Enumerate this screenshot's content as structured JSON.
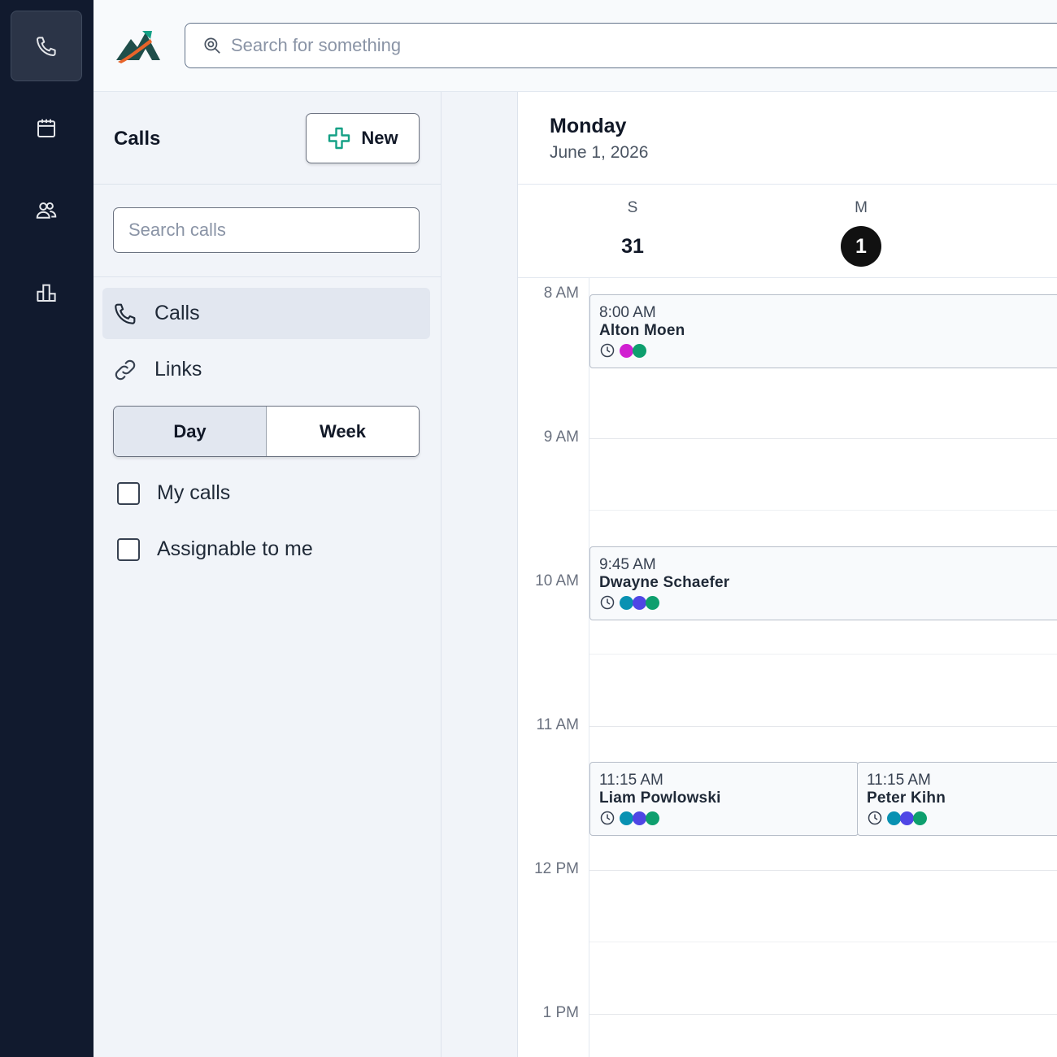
{
  "rail": {
    "items": [
      {
        "icon": "phone-icon",
        "active": true
      },
      {
        "icon": "calendar-icon",
        "active": false
      },
      {
        "icon": "users-icon",
        "active": false
      },
      {
        "icon": "reports-icon",
        "active": false
      }
    ]
  },
  "topbar": {
    "search_placeholder": "Search for something"
  },
  "panel": {
    "title": "Calls",
    "new_label": "New",
    "search_placeholder": "Search calls",
    "nav": [
      {
        "label": "Calls",
        "icon": "phone-icon",
        "active": true
      },
      {
        "label": "Links",
        "icon": "link-icon",
        "active": false
      }
    ],
    "view_toggle": {
      "day": "Day",
      "week": "Week",
      "selected": "Day"
    },
    "filters": [
      {
        "label": "My calls",
        "checked": false
      },
      {
        "label": "Assignable to me",
        "checked": false
      }
    ]
  },
  "calendar": {
    "day_name": "Monday",
    "date": "June 1, 2026",
    "week": [
      {
        "letter": "S",
        "number": "31",
        "today": false
      },
      {
        "letter": "M",
        "number": "1",
        "today": true
      }
    ],
    "hours": [
      "8 AM",
      "9 AM",
      "10 AM",
      "11 AM",
      "12 PM",
      "1 PM"
    ],
    "events": [
      {
        "time": "8:00 AM",
        "name": "Alton Moen",
        "dots": [
          "#d11fd1",
          "#0e9f6e"
        ]
      },
      {
        "time": "9:45 AM",
        "name": "Dwayne Schaefer",
        "dots": [
          "#0891b2",
          "#4f46e5",
          "#0e9f6e"
        ]
      },
      {
        "time": "11:15 AM",
        "name": "Liam Powlowski",
        "dots": [
          "#0891b2",
          "#4f46e5",
          "#0e9f6e"
        ]
      },
      {
        "time": "11:15 AM",
        "name": "Peter Kihn",
        "dots": [
          "#0891b2",
          "#4f46e5",
          "#0e9f6e"
        ]
      }
    ]
  },
  "colors": {
    "rail_bg": "#111a2e",
    "today_bg": "#111111",
    "new_icon": "#14a085"
  }
}
